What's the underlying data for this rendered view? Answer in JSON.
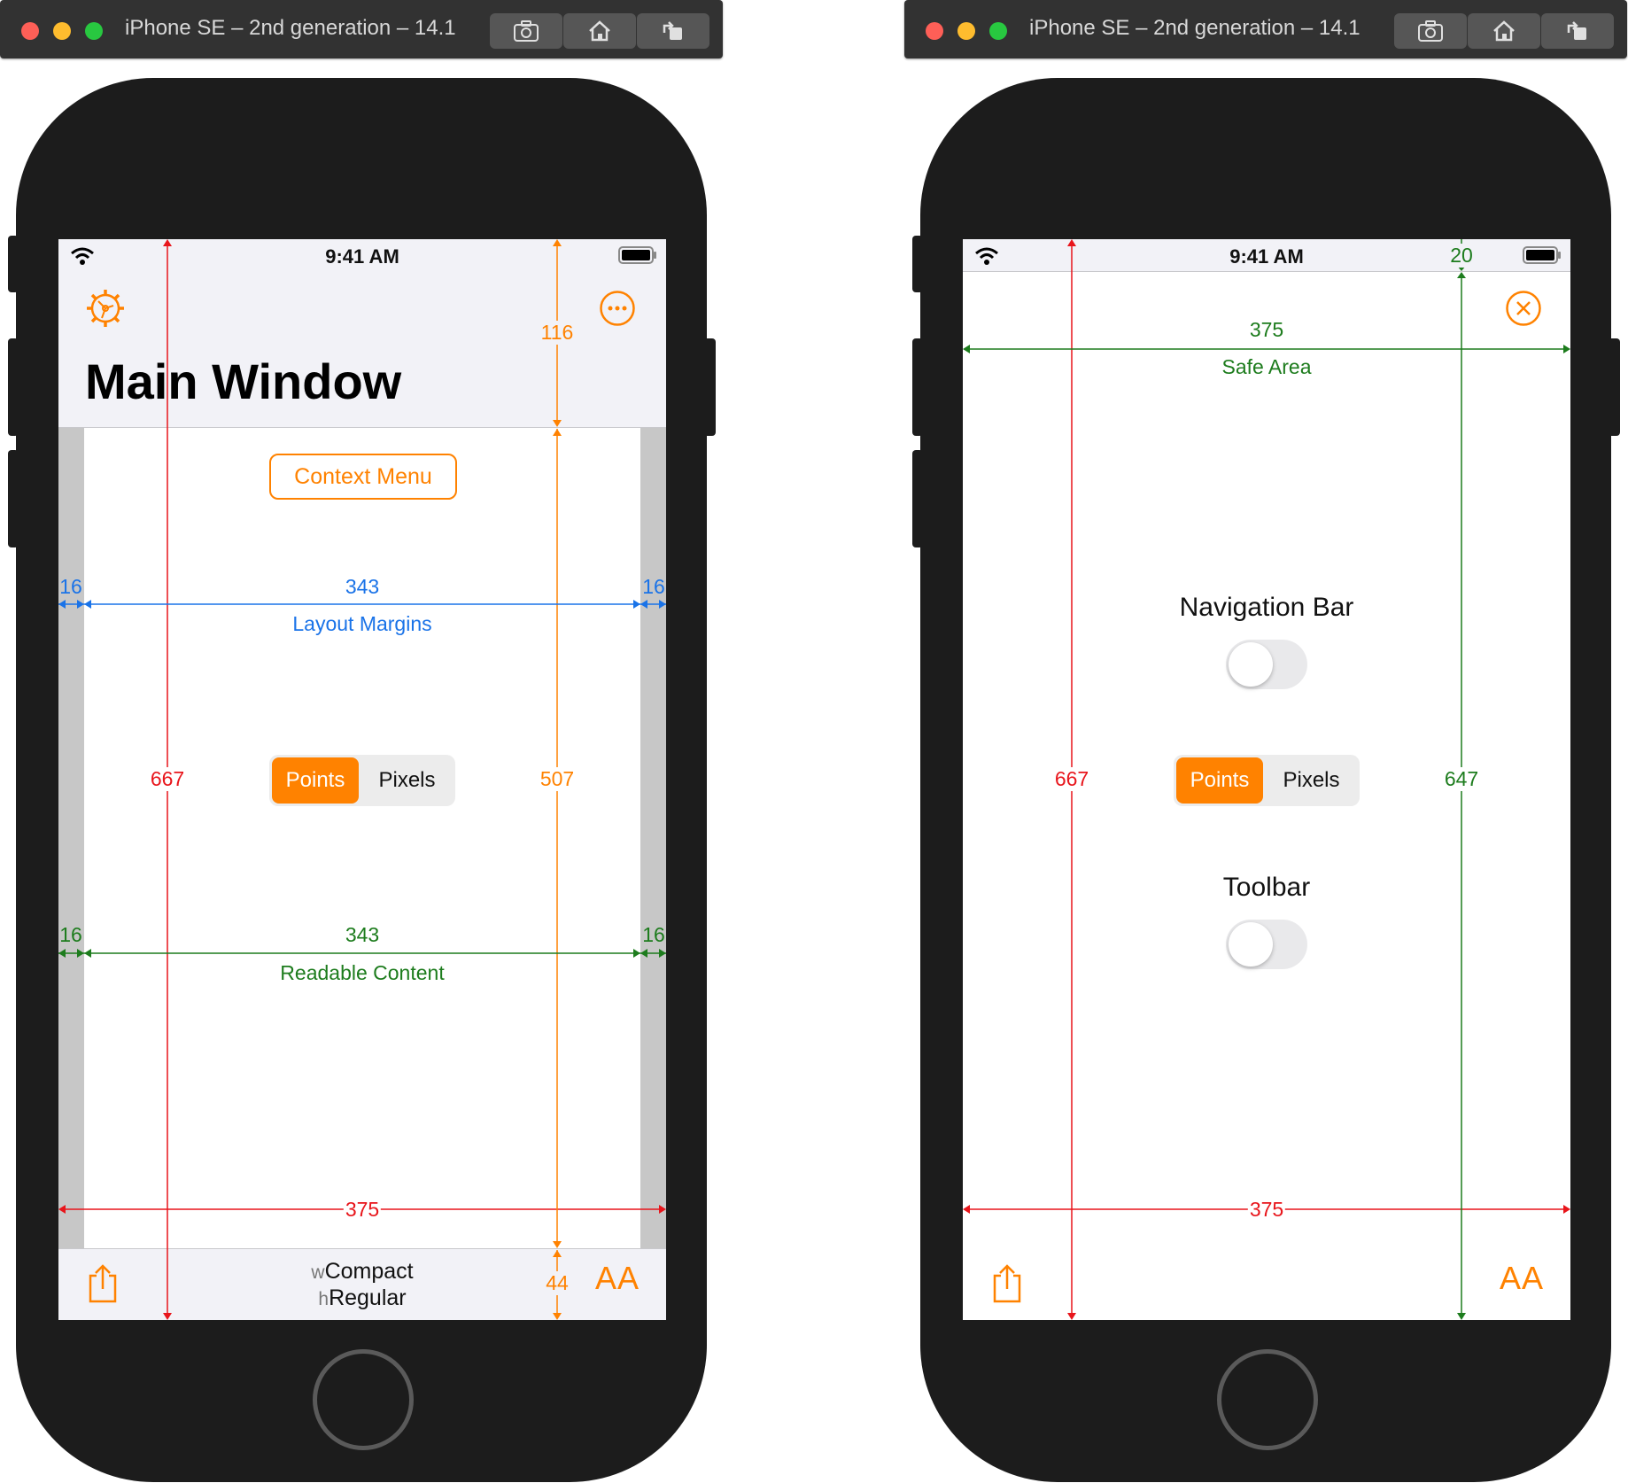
{
  "simulators": [
    {
      "window_title": "iPhone SE – 2nd generation – 14.1",
      "status_time": "9:41 AM",
      "nav_title": "Main Window",
      "context_menu_label": "Context Menu",
      "total_width": "375",
      "total_height": "667",
      "nav_height": "116",
      "content_height": "507",
      "toolbar_height": "44",
      "layout_margins": {
        "left": "16",
        "width": "343",
        "right": "16",
        "label": "Layout Margins"
      },
      "readable_content": {
        "left": "16",
        "width": "343",
        "right": "16",
        "label": "Readable Content"
      },
      "segmented": {
        "selected": "Points",
        "other": "Pixels"
      },
      "size_class": {
        "w_prefix": "w",
        "w_value": "Compact",
        "h_prefix": "h",
        "h_value": "Regular"
      },
      "text_size_label": "AA",
      "icons": [
        "settings-gear-icon",
        "more-ellipsis-icon",
        "share-icon"
      ]
    },
    {
      "window_title": "iPhone SE – 2nd generation – 14.1",
      "status_time": "9:41 AM",
      "status_height": "20",
      "safe_area": {
        "width": "375",
        "label": "Safe Area"
      },
      "total_width": "375",
      "total_height": "667",
      "safe_height": "647",
      "nav_bar_label": "Navigation Bar",
      "toolbar_label": "Toolbar",
      "nav_bar_toggle": false,
      "toolbar_toggle": false,
      "segmented": {
        "selected": "Points",
        "other": "Pixels"
      },
      "text_size_label": "AA",
      "icons": [
        "close-circle-icon",
        "share-icon"
      ]
    }
  ],
  "colors": {
    "accent": "#ff8200",
    "red_measure": "#e8151b",
    "orange_measure": "#ff8200",
    "blue_measure": "#1a73e8",
    "green_measure": "#1d7c1d",
    "device": "#1c1c1c",
    "bar_background": "#f2f2f7",
    "margin_gray": "#c7c7c7"
  }
}
